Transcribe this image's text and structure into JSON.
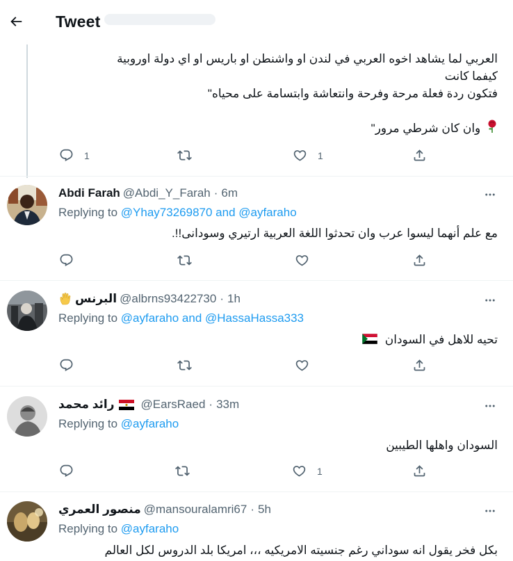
{
  "header": {
    "title": "Tweet"
  },
  "top_tweet": {
    "lines": [
      "العربي لما يشاهد اخوه العربي في لندن او  واشنطن او باريس او اي دولة اوروبية",
      "كيفما كانت",
      "فتكون ردة فعلة مرحة وفرحة وانتعاشة وابتسامة  على محياه\"",
      "",
      "وان كان شرطي مرور\""
    ],
    "reply_count": "1",
    "like_count": "1"
  },
  "replies": [
    {
      "name": "Abdi Farah",
      "handle": "@Abdi_Y_Farah",
      "time": "6m",
      "replying_prefix": "Replying to",
      "mentions": "@Yhay73269870 and @ayfaraho",
      "text": "مع علم أنهما ليسوا عرب وان تحدثوا اللغة العربية ارتيري وسودانى!!.",
      "reply_count": "",
      "like_count": ""
    },
    {
      "name": "البرنس",
      "handle": "@albrns93422730",
      "time": "1h",
      "replying_prefix": "Replying to",
      "mentions": "@ayfaraho and @HassaHassa333",
      "text": "تحيه للاهل في السودان",
      "reply_count": "",
      "like_count": ""
    },
    {
      "name": "رائد محمد",
      "handle": "@EarsRaed",
      "time": "33m",
      "replying_prefix": "Replying to",
      "mentions": "@ayfaraho",
      "text": "السودان واهلها الطيبين",
      "reply_count": "",
      "like_count": "1"
    },
    {
      "name": "منصور العمري",
      "handle": "@mansouralamri67",
      "time": "5h",
      "replying_prefix": "Replying to",
      "mentions": "@ayfaraho",
      "text": "بكل فخر يقول انه سوداني رغم جنسيته الامريكيه ،،، امريكا بلد الدروس لكل العالم",
      "reply_count": "",
      "like_count": ""
    }
  ],
  "colors": {
    "link": "#1d9bf0",
    "secondary": "#536471",
    "text": "#0f1419"
  },
  "icons": [
    "back-arrow-icon",
    "reply-icon",
    "retweet-icon",
    "like-icon",
    "share-icon",
    "more-icon",
    "rose-emoji-icon",
    "raised-hand-emoji-icon",
    "egypt-flag-icon",
    "sudan-flag-icon"
  ]
}
